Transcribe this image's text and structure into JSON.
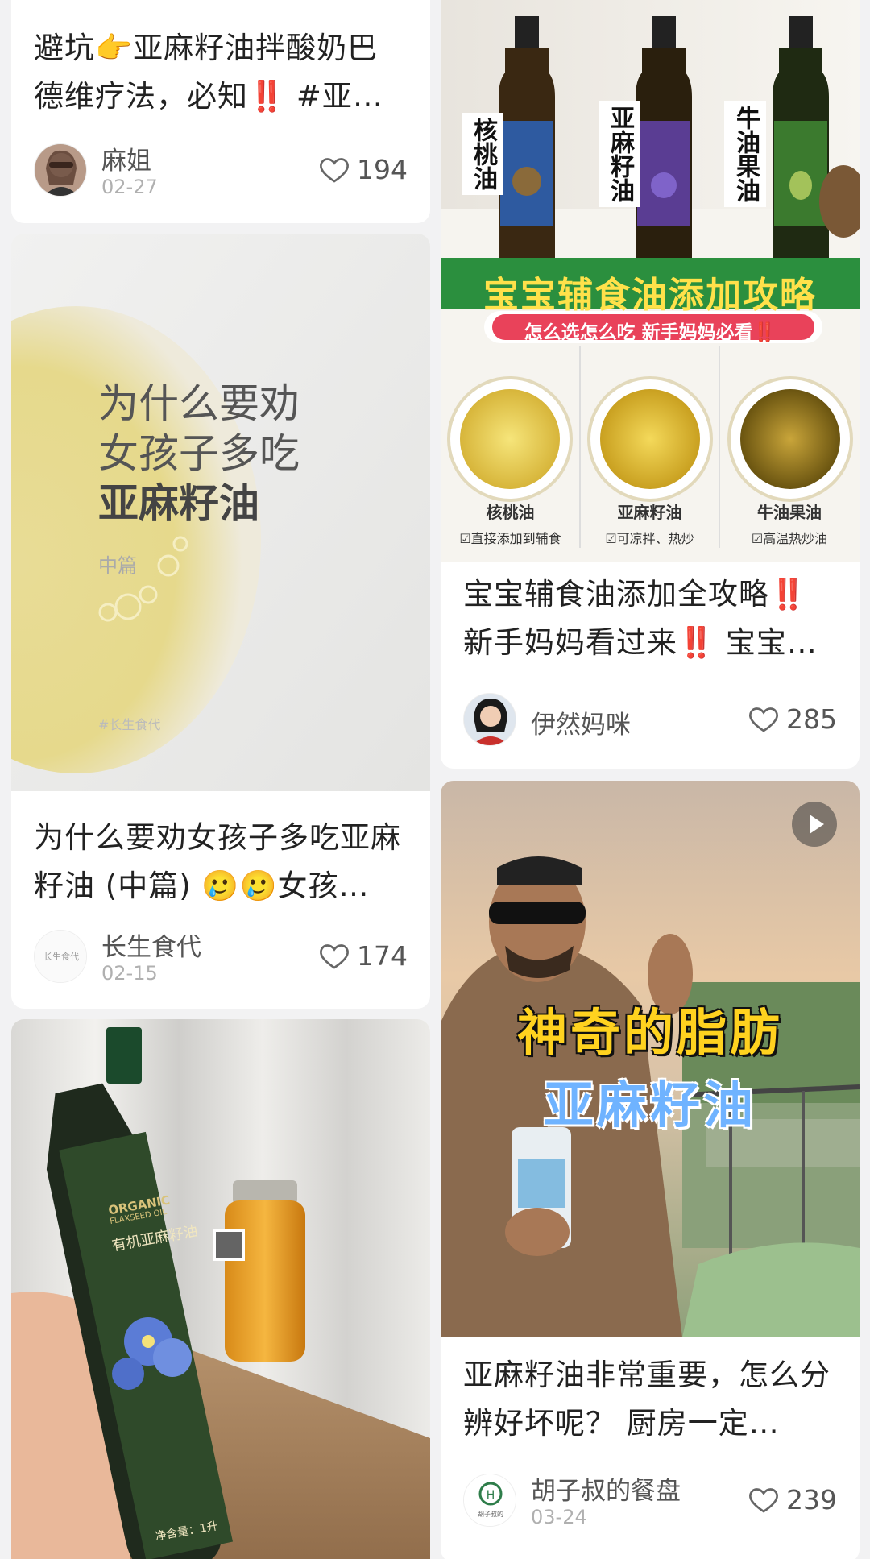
{
  "cards": {
    "c1": {
      "title": "避坑👉亚麻籽油拌酸奶巴德维疗法，必知‼️ #亚…",
      "author": "麻姐",
      "date": "02-27",
      "likes": "194"
    },
    "c2": {
      "cover_line1": "为什么要劝",
      "cover_line2": "女孩子多吃",
      "cover_line3": "亚麻籽油",
      "cover_sub": "中篇",
      "cover_tag": "#长生食代",
      "title": "为什么要劝女孩子多吃亚麻籽油 (中篇) 🥲🥲女孩…",
      "author": "长生食代",
      "date": "02-15",
      "likes": "174"
    },
    "c3": {
      "label_organic": "ORGANIC",
      "label_flaxseed": "FLAXSEED OIL",
      "label_cn": "有机亚麻籽油",
      "label_net": "净含量：1升"
    },
    "c4": {
      "bottle1": "核桃油",
      "bottle2": "亚麻籽油",
      "bottle3": "牛油果油",
      "banner": "宝宝辅食油添加攻略",
      "subbanner": "怎么选怎么吃  新手妈妈必看‼️",
      "oil1": "核桃油",
      "oil2": "亚麻籽油",
      "oil3": "牛油果油",
      "tip1": "☑直接添加到辅食",
      "tip2": "☑可凉拌、热炒",
      "tip3": "☑高温热炒油",
      "title": "宝宝辅食油添加全攻略‼️新手妈妈看过来‼️ 宝宝…",
      "author": "伊然妈咪",
      "likes": "285"
    },
    "c5": {
      "overlay1": "神奇的脂肪",
      "overlay2": "亚麻籽油",
      "title": "亚麻籽油非常重要，怎么分辨好坏呢？ 厨房一定…",
      "author": "胡子叔的餐盘",
      "date": "03-24",
      "likes": "239"
    }
  },
  "colors": {
    "banner_green": "#1f8a3a",
    "banner_yellow": "#ffe14a",
    "overlay_yellow": "#ffd21f",
    "overlay_blue": "#6fb3ff"
  }
}
